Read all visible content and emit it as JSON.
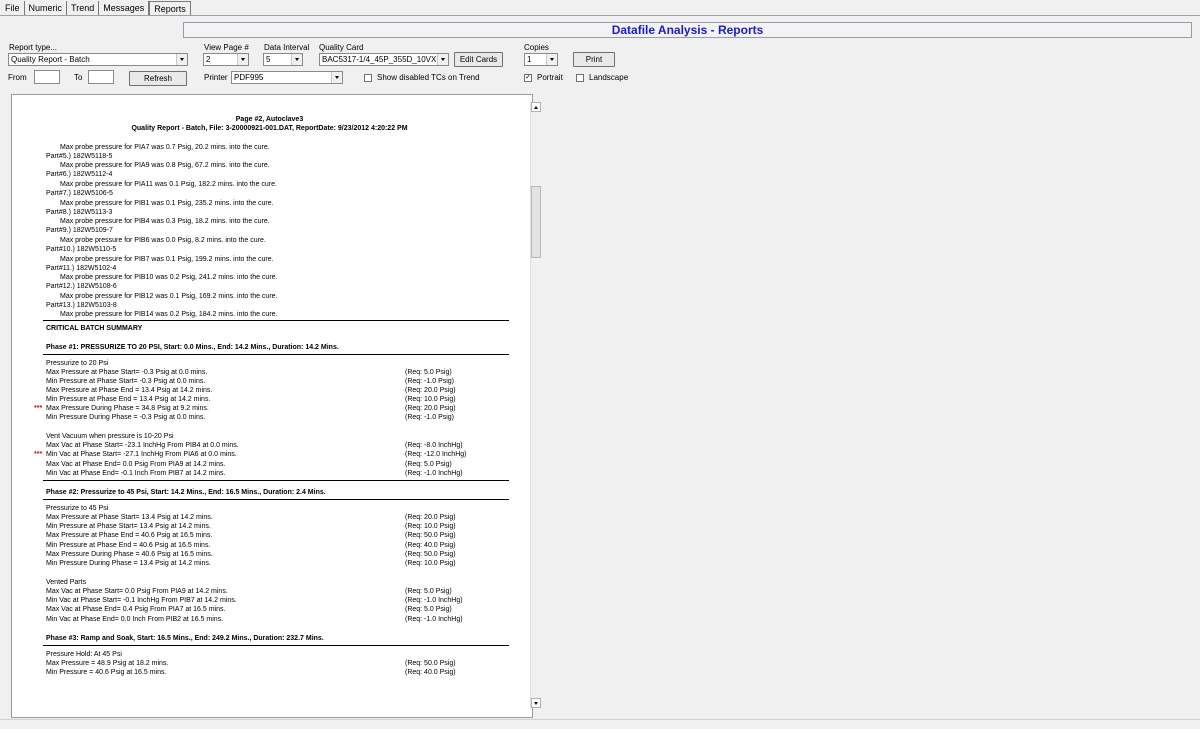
{
  "tabs": [
    "File",
    "Numeric",
    "Trend",
    "Messages",
    "Reports"
  ],
  "title": "Datafile Analysis - Reports",
  "controls": {
    "report_type_label": "Report type...",
    "report_type_value": "Quality Report - Batch",
    "view_page_label": "View Page #",
    "view_page_value": "2",
    "data_interval_label": "Data Interval",
    "data_interval_value": "5",
    "quality_card_label": "Quality Card",
    "quality_card_value": "BAC5317-1/4_45P_355D_10VX",
    "edit_cards_label": "Edit Cards",
    "copies_label": "Copies",
    "copies_value": "1",
    "print_label": "Print",
    "from_label": "From",
    "to_label": "To",
    "refresh_label": "Refresh",
    "printer_label": "Printer",
    "printer_value": "PDF995",
    "show_disabled_label": "Show disabled TCs on Trend",
    "portrait_label": "Portrait",
    "landscape_label": "Landscape"
  },
  "report": {
    "header1": "Page #2,  Autoclave3",
    "header2": "Quality Report - Batch,  File: 3-20000921-001.DAT,  ReportDate: 9/23/2012  4:20:22 PM",
    "parts": [
      "Max probe pressure for PIA7 was 0.7 Psig, 20.2 mins. into the cure.",
      "Part#5.) 182W5118-5",
      "Max probe pressure for PIA9 was 0.8 Psig, 67.2 mins. into the cure.",
      "Part#6.) 182W5112-4",
      "Max probe pressure for PIA11 was 0.1 Psig, 182.2 mins. into the cure.",
      "Part#7.) 182W5106-5",
      "Max probe pressure for PIB1 was 0.1 Psig, 235.2 mins. into the cure.",
      "Part#8.) 182W5113-3",
      "Max probe pressure for PIB4 was 0.3 Psig, 18.2 mins. into the cure.",
      "Part#9.) 182W5109-7",
      "Max probe pressure for PIB6 was 0.0 Psig, 8.2 mins. into the cure.",
      "Part#10.) 182W5110-5",
      "Max probe pressure for PIB7 was 0.1 Psig, 199.2 mins. into the cure.",
      "Part#11.) 182W5102-4",
      "Max probe pressure for PIB10 was 0.2 Psig, 241.2 mins. into the cure.",
      "Part#12.) 182W5108-6",
      "Max probe pressure for PIB12 was 0.1 Psig, 169.2 mins. into the cure.",
      "Part#13.) 182W5103-8",
      "Max probe pressure for PIB14 was 0.2 Psig, 184.2 mins. into the cure."
    ],
    "critical_summary": "CRITICAL BATCH SUMMARY",
    "phase1_title": "Phase #1: PRESSURIZE TO 20 PSI, Start: 0.0 Mins., End: 14.2 Mins., Duration: 14.2 Mins.",
    "phase1_group1_title": "Pressurize to 20 Psi",
    "phase1_group1": [
      {
        "text": "Max Pressure at Phase Start= -0.3 Psig at 0.0 mins.",
        "req": "(Req: 5.0 Psig)",
        "flag": ""
      },
      {
        "text": "Min Pressure at Phase Start= -0.3 Psig at 0.0 mins.",
        "req": "(Req: -1.0 Psig)",
        "flag": ""
      },
      {
        "text": "Max Pressure at Phase End = 13.4 Psig at 14.2 mins.",
        "req": "(Req: 20.0 Psig)",
        "flag": ""
      },
      {
        "text": "Min Pressure at Phase End = 13.4 Psig at 14.2 mins.",
        "req": "(Req: 10.0 Psig)",
        "flag": ""
      },
      {
        "text": "Max Pressure During Phase = 34.8 Psig at 9.2 mins.",
        "req": "(Req: 20.0 Psig)",
        "flag": "***"
      },
      {
        "text": "Min Pressure During Phase = -0.3 Psig at 0.0 mins.",
        "req": "(Req: -1.0 Psig)",
        "flag": ""
      }
    ],
    "phase1_group2_title": "Vent Vacuum when pressure is 10-20 Psi",
    "phase1_group2": [
      {
        "text": "Max Vac at Phase Start= -23.1 InchHg From PIB4 at 0.0 mins.",
        "req": "(Req: -8.0 InchHg)",
        "flag": ""
      },
      {
        "text": "Min Vac at Phase Start= -27.1 InchHg From PIA6 at 0.0 mins.",
        "req": "(Req: -12.0 InchHg)",
        "flag": "***"
      },
      {
        "text": "Max Vac at Phase End= 0.0 Psig From PIA9 at 14.2 mins.",
        "req": "(Req: 5.0 Psig)",
        "flag": ""
      },
      {
        "text": "Min Vac at Phase End= -0.1 Inch From PIB7 at 14.2 mins.",
        "req": "(Req: -1.0 InchHg)",
        "flag": ""
      }
    ],
    "phase2_title": "Phase #2: Pressurize to 45 Psi, Start: 14.2 Mins., End: 16.5 Mins., Duration: 2.4 Mins.",
    "phase2_group1_title": "Pressurize to 45 Psi",
    "phase2_group1": [
      {
        "text": "Max Pressure at Phase Start= 13.4 Psig at 14.2 mins.",
        "req": "(Req: 20.0 Psig)"
      },
      {
        "text": "Min Pressure at Phase Start= 13.4 Psig at 14.2 mins.",
        "req": "(Req: 10.0 Psig)"
      },
      {
        "text": "Max Pressure at Phase End = 40.6 Psig at 16.5 mins.",
        "req": "(Req: 50.0 Psig)"
      },
      {
        "text": "Min Pressure at Phase End = 40.6 Psig at 16.5 mins.",
        "req": "(Req: 40.0 Psig)"
      },
      {
        "text": "Max Pressure During Phase = 40.6 Psig at 16.5 mins.",
        "req": "(Req: 50.0 Psig)"
      },
      {
        "text": "Min Pressure During Phase = 13.4 Psig at 14.2 mins.",
        "req": "(Req: 10.0 Psig)"
      }
    ],
    "phase2_group2_title": "Vented Parts",
    "phase2_group2": [
      {
        "text": "Max Vac at Phase Start= 0.0 Psig From PIA9 at 14.2 mins.",
        "req": "(Req: 5.0 Psig)"
      },
      {
        "text": "Min Vac at Phase Start= -0.1 InchHg From PIB7 at 14.2 mins.",
        "req": "(Req: -1.0 InchHg)"
      },
      {
        "text": "Max Vac at Phase End= 0.4 Psig From PIA7 at 16.5 mins.",
        "req": "(Req: 5.0 Psig)"
      },
      {
        "text": "Min Vac at Phase End= 0.0 Inch From PIB2 at 16.5 mins.",
        "req": "(Req: -1.0 InchHg)"
      }
    ],
    "phase3_title": "Phase #3: Ramp and Soak, Start: 16.5 Mins., End: 249.2 Mins., Duration: 232.7 Mins.",
    "phase3_group1_title": "Pressure Hold:  At 45 Psi",
    "phase3_group1": [
      {
        "text": "Max Pressure = 48.9 Psig at 18.2 mins.",
        "req": "(Req: 50.0 Psig)"
      },
      {
        "text": "Min Pressure = 40.6 Psig at 16.5 mins.",
        "req": "(Req: 40.0 Psig)"
      }
    ]
  }
}
